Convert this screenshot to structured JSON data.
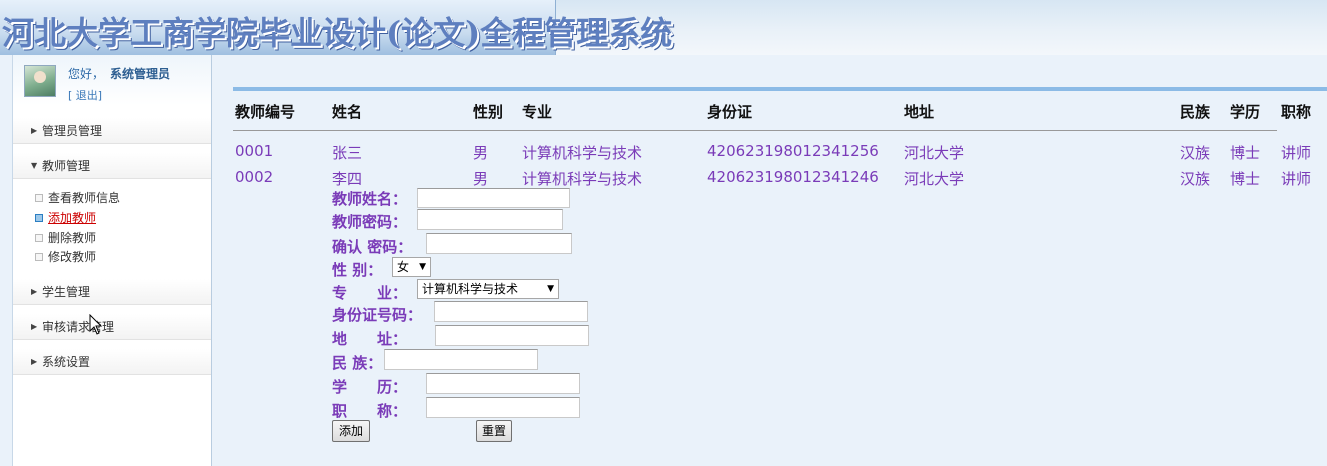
{
  "header": {
    "title": "河北大学工商学院毕业设计(论文)全程管理系统"
  },
  "user": {
    "greeting": "您好，",
    "name": "系统管理员",
    "logout": "[ 退出]"
  },
  "sidebar": {
    "menus": [
      {
        "label": "管理员管理",
        "expanded": false
      },
      {
        "label": "教师管理",
        "expanded": true,
        "items": [
          {
            "label": "查看教师信息",
            "active": false
          },
          {
            "label": "添加教师",
            "active": true
          },
          {
            "label": "删除教师",
            "active": false
          },
          {
            "label": "修改教师",
            "active": false
          }
        ]
      },
      {
        "label": "学生管理",
        "expanded": false
      },
      {
        "label": "审核请求管理",
        "expanded": false
      },
      {
        "label": "系统设置",
        "expanded": false
      }
    ]
  },
  "table": {
    "headers": [
      "教师编号",
      "姓名",
      "性别",
      "专业",
      "身份证",
      "地址",
      "民族",
      "学历",
      "职称"
    ],
    "rows": [
      [
        "0001",
        "张三",
        "男",
        "计算机科学与技术",
        "420623198012341256",
        "河北大学",
        "汉族",
        "博士",
        "讲师"
      ],
      [
        "0002",
        "李四",
        "男",
        "计算机科学与技术",
        "420623198012341246",
        "河北大学",
        "汉族",
        "博士",
        "讲师"
      ]
    ]
  },
  "form": {
    "name_label": "教师姓名：",
    "password_label": "教师密码：",
    "confirm_label": "确认 密码：",
    "gender_label": "性 别：",
    "gender_value": "女",
    "major_label": "专　　业：",
    "major_value": "计算机科学与技术",
    "idcard_label": "身份证号码：",
    "address_label": "地　　址：",
    "ethnic_label": "民 族：",
    "education_label": "学　　历：",
    "title_label": "职　　称：",
    "add_button": "添加",
    "reset_button": "重置"
  },
  "colors": {
    "data_text": "#7a3bb8",
    "accent": "#8cbbe6",
    "active_link": "#cc0000"
  }
}
